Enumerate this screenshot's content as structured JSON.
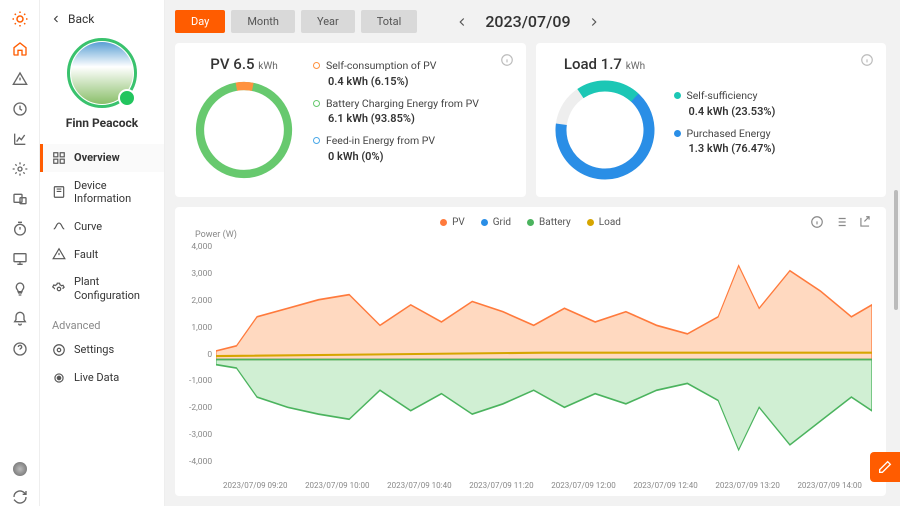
{
  "iconbar": [
    "sun",
    "home",
    "warn",
    "clock",
    "chart",
    "gear",
    "devices",
    "timer",
    "monitor",
    "bulb",
    "bell",
    "help"
  ],
  "back_label": "Back",
  "user_name": "Finn Peacock",
  "menu": {
    "items": [
      {
        "icon": "grid",
        "label": "Overview",
        "active": true
      },
      {
        "icon": "device",
        "label": "Device\nInformation"
      },
      {
        "icon": "curve",
        "label": "Curve"
      },
      {
        "icon": "fault",
        "label": "Fault"
      },
      {
        "icon": "config",
        "label": "Plant\nConfiguration"
      }
    ],
    "advanced_label": "Advanced",
    "advanced": [
      {
        "icon": "settings",
        "label": "Settings"
      },
      {
        "icon": "live",
        "label": "Live Data"
      }
    ]
  },
  "range": {
    "options": [
      "Day",
      "Month",
      "Year",
      "Total"
    ],
    "active": 0
  },
  "date": "2023/07/09",
  "pv_card": {
    "title": "PV",
    "value": "6.5",
    "unit": "kWh",
    "items": [
      {
        "color": "#ff923f",
        "label": "Self-consumption of PV",
        "value": "0.4 kWh (6.15%)"
      },
      {
        "color": "#67c96e",
        "label": "Battery Charging Energy from PV",
        "value": "6.1 kWh (93.85%)"
      },
      {
        "color": "#4aa8e8",
        "label": "Feed-in Energy from PV",
        "value": "0 kWh (0%)"
      }
    ]
  },
  "load_card": {
    "title": "Load",
    "value": "1.7",
    "unit": "kWh",
    "items": [
      {
        "color": "#1cc7b5",
        "label": "Self-sufficiency",
        "value": "0.4 kWh (23.53%)"
      },
      {
        "color": "#2a8ee6",
        "label": "Purchased Energy",
        "value": "1.3 kWh (76.47%)"
      }
    ]
  },
  "chart": {
    "legend": [
      {
        "label": "PV",
        "color": "#ff7a3c"
      },
      {
        "label": "Grid",
        "color": "#2a8ee6"
      },
      {
        "label": "Battery",
        "color": "#4bb35e"
      },
      {
        "label": "Load",
        "color": "#d6a500"
      }
    ],
    "ylabel": "Power (W)",
    "yticks": [
      "4,000",
      "3,000",
      "2,000",
      "1,000",
      "0",
      "-1,000",
      "-2,000",
      "-3,000",
      "-4,000"
    ],
    "xticks": [
      "2023/07/09 09:20",
      "2023/07/09 10:00",
      "2023/07/09 10:40",
      "2023/07/09 11:20",
      "2023/07/09 12:00",
      "2023/07/09 12:40",
      "2023/07/09 13:20",
      "2023/07/09 14:00"
    ]
  },
  "chart_data": {
    "type": "area",
    "ylabel": "Power (W)",
    "ylim": [
      -4000,
      4000
    ],
    "x": [
      "09:20",
      "10:00",
      "10:40",
      "11:20",
      "12:00",
      "12:40",
      "13:20",
      "14:00"
    ],
    "series": [
      {
        "name": "PV",
        "color": "#ff7a3c",
        "values": [
          400,
          1600,
          2000,
          1800,
          1600,
          1400,
          3400,
          1800
        ]
      },
      {
        "name": "Battery",
        "color": "#4bb35e",
        "values": [
          -300,
          -1500,
          -2000,
          -1500,
          -1400,
          -1200,
          -3200,
          -1600
        ]
      },
      {
        "name": "Grid",
        "color": "#2a8ee6",
        "values": [
          0,
          0,
          0,
          0,
          0,
          0,
          0,
          0
        ]
      },
      {
        "name": "Load",
        "color": "#d6a500",
        "values": [
          100,
          150,
          150,
          200,
          180,
          200,
          200,
          200
        ]
      }
    ]
  }
}
